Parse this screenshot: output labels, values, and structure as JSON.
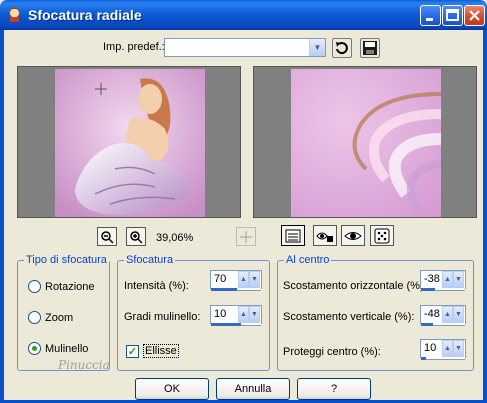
{
  "window": {
    "title": "Sfocatura radiale"
  },
  "preset": {
    "label": "Imp. predef.:",
    "value": ""
  },
  "zoom": {
    "level": "39,06%"
  },
  "blur_type": {
    "legend": "Tipo di sfocatura",
    "options": [
      "Rotazione",
      "Zoom",
      "Mulinello"
    ],
    "selected": "Mulinello"
  },
  "blur": {
    "legend": "Sfocatura",
    "intensity_label": "Intensità (%):",
    "intensity_value": "70",
    "twirl_label": "Gradi mulinello:",
    "twirl_value": "10",
    "ellipse_label": "Ellisse",
    "ellipse_checked": true
  },
  "center": {
    "legend": "Al centro",
    "h_offset_label": "Scostamento orizzontale (%):",
    "h_offset_value": "-38",
    "v_offset_label": "Scostamento verticale (%):",
    "v_offset_value": "-48",
    "protect_label": "Proteggi centro (%):",
    "protect_value": "10"
  },
  "buttons": {
    "ok": "OK",
    "cancel": "Annulla",
    "help": "?"
  },
  "watermark": "Pinuccia",
  "colors": {
    "accent": "#0046d5",
    "titlebar": "#0a59d6",
    "dialog_bg": "#ece9d8"
  }
}
